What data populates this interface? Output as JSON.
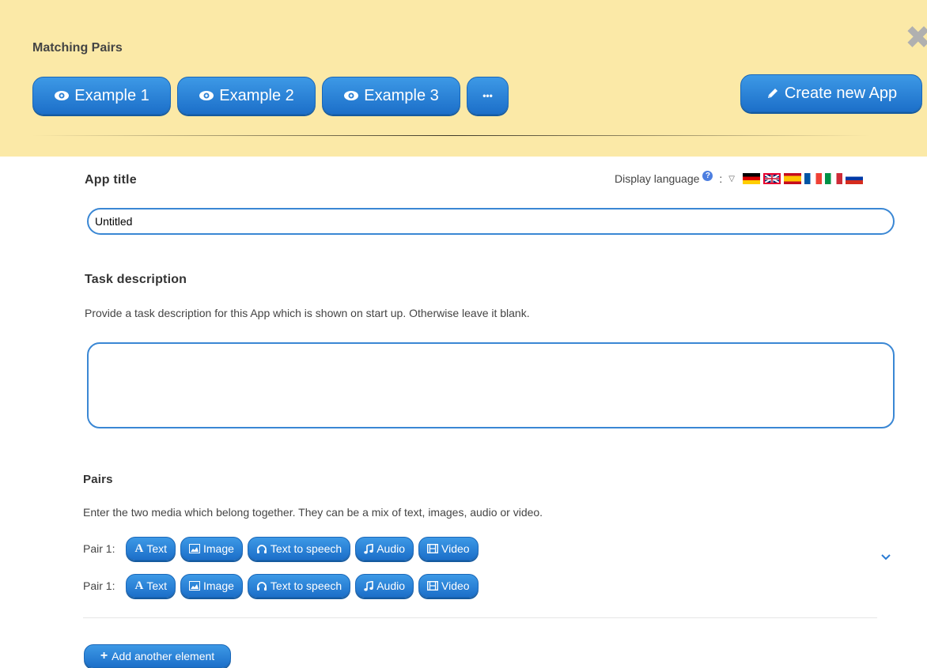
{
  "header": {
    "title": "Matching Pairs",
    "examples": [
      {
        "label": "Example 1"
      },
      {
        "label": "Example 2"
      },
      {
        "label": "Example 3"
      }
    ],
    "more_label": "•••",
    "create_label": "Create new App",
    "close_icon": "close-icon"
  },
  "app_title": {
    "label": "App title",
    "value": "Untitled"
  },
  "language": {
    "label": "Display language",
    "help": "?",
    "separator": ":",
    "flags": [
      "de",
      "gb",
      "es",
      "fr",
      "it",
      "ru"
    ],
    "selected": "gb"
  },
  "task": {
    "label": "Task description",
    "hint": "Provide a task description for this App which is shown on start up. Otherwise leave it blank.",
    "value": ""
  },
  "pairs": {
    "label": "Pairs",
    "hint": "Enter the two media which belong together. They can be a mix of text, images, audio or video.",
    "rows": [
      {
        "label": "Pair 1:"
      },
      {
        "label": "Pair 1:"
      }
    ],
    "media_buttons": [
      "Text",
      "Image",
      "Text to speech",
      "Audio",
      "Video"
    ],
    "add_label": "Add another element"
  },
  "colors": {
    "header_bg": "#fbe9a7",
    "button_blue": "#2a82d6",
    "input_border": "#3a87d4"
  }
}
